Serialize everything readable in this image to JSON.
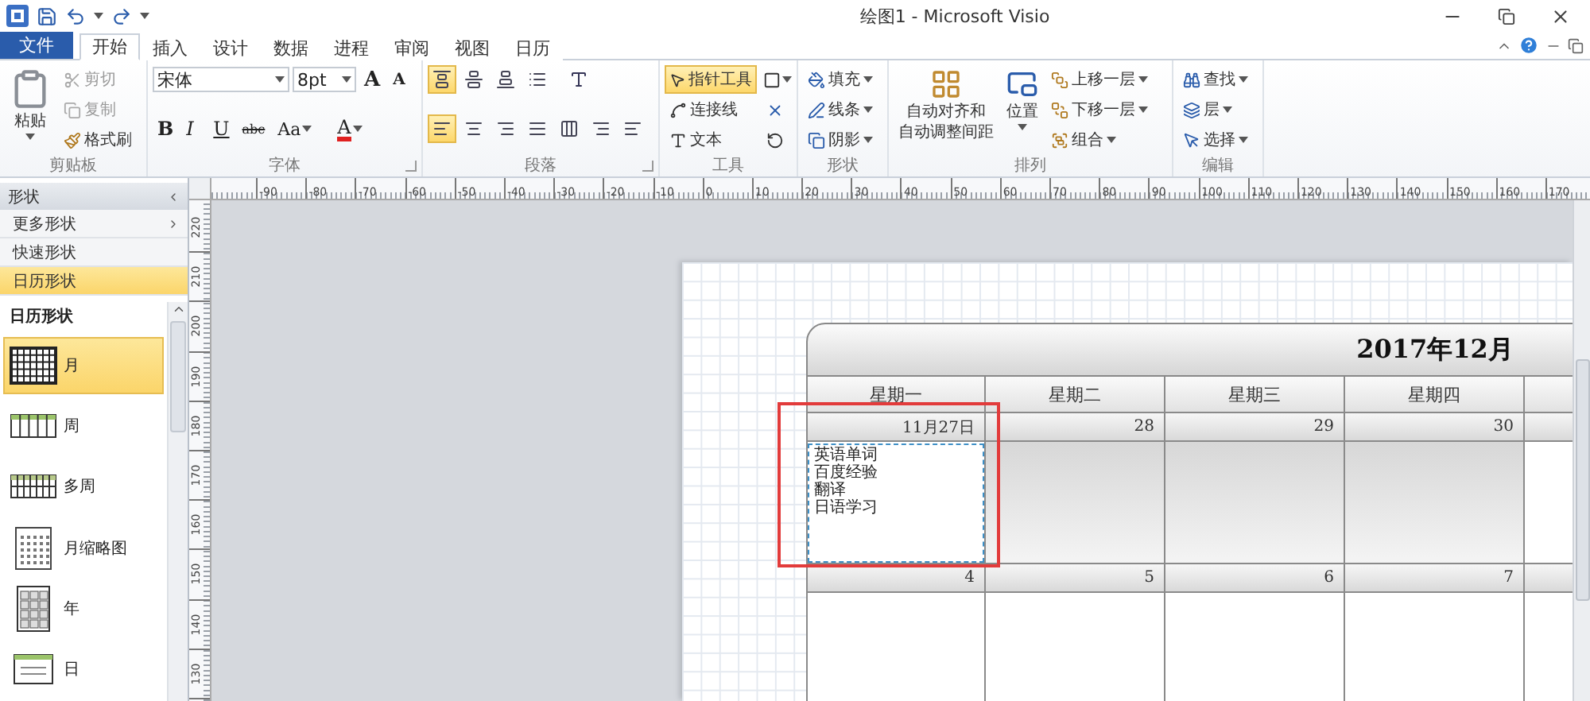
{
  "title_bar": {
    "title": "绘图1 - Microsoft Visio"
  },
  "tabs": [
    {
      "label": "文件",
      "kind": "file",
      "selected": false
    },
    {
      "label": "开始",
      "kind": "tab",
      "selected": true
    },
    {
      "label": "插入",
      "kind": "tab",
      "selected": false
    },
    {
      "label": "设计",
      "kind": "tab",
      "selected": false
    },
    {
      "label": "数据",
      "kind": "tab",
      "selected": false
    },
    {
      "label": "进程",
      "kind": "tab",
      "selected": false
    },
    {
      "label": "审阅",
      "kind": "tab",
      "selected": false
    },
    {
      "label": "视图",
      "kind": "tab",
      "selected": false
    },
    {
      "label": "日历",
      "kind": "tab",
      "selected": false
    }
  ],
  "ribbon": {
    "clipboard": {
      "label": "剪贴板",
      "paste": "粘贴",
      "items": [
        {
          "label": "剪切",
          "disabled": true
        },
        {
          "label": "复制",
          "disabled": true
        },
        {
          "label": "格式刷",
          "disabled": false
        }
      ]
    },
    "font": {
      "label": "字体",
      "font_name": "宋体",
      "font_size": "8pt",
      "grow": "A",
      "shrink": "A",
      "bold": "B",
      "italic": "I",
      "underline": "U",
      "strikethrough": "abc",
      "change_case": "Aa",
      "font_color": "A"
    },
    "paragraph": {
      "label": "段落",
      "vertical_align": [
        {
          "selected": true
        },
        {
          "selected": false
        },
        {
          "selected": false
        }
      ],
      "horizontal_align": [
        {
          "selected": true
        },
        {
          "selected": false
        },
        {
          "selected": false
        },
        {
          "selected": false
        }
      ]
    },
    "tools": {
      "label": "工具",
      "items": [
        {
          "label": "指针工具",
          "selected": true
        },
        {
          "label": "连接线",
          "selected": false
        },
        {
          "label": "文本",
          "selected": false
        }
      ]
    },
    "shape": {
      "label": "形状",
      "items": [
        "填充",
        "线条",
        "阴影"
      ]
    },
    "arrange": {
      "label": "排列",
      "auto_align": [
        "自动对齐和",
        "自动调整间距"
      ],
      "position": "位置",
      "items": [
        "上移一层",
        "下移一层",
        "组合"
      ]
    },
    "editing": {
      "label": "编辑",
      "items": [
        "查找",
        "层",
        "选择"
      ]
    }
  },
  "shapes_pane": {
    "title": "形状",
    "menu": [
      {
        "label": "更多形状",
        "kind": "submenu",
        "selected": false
      },
      {
        "label": "快速形状",
        "kind": "item",
        "selected": false
      },
      {
        "label": "日历形状",
        "kind": "item",
        "selected": true
      }
    ],
    "stencil_title": "日历形状",
    "stencil": [
      {
        "label": "月",
        "selected": true
      },
      {
        "label": "周",
        "selected": false
      },
      {
        "label": "多周",
        "selected": false
      },
      {
        "label": "月缩略图",
        "selected": false
      },
      {
        "label": "年",
        "selected": false
      },
      {
        "label": "日",
        "selected": false
      }
    ]
  },
  "rulers": {
    "horizontal": [
      "-90",
      "-80",
      "-70",
      "-60",
      "-50",
      "-40",
      "-30",
      "-20",
      "-10",
      "0",
      "10",
      "20",
      "30",
      "40",
      "50",
      "60",
      "70",
      "80",
      "90",
      "100",
      "110",
      "120",
      "130",
      "140",
      "150",
      "160",
      "170"
    ],
    "vertical": [
      "220",
      "210",
      "200",
      "190",
      "180",
      "170",
      "160",
      "150",
      "140",
      "130"
    ]
  },
  "calendar": {
    "title": "2017年12月",
    "weekdays": [
      "星期一",
      "星期二",
      "星期三",
      "星期四"
    ],
    "weeks": [
      {
        "dates": [
          "11月27日",
          "28",
          "29",
          "30"
        ],
        "cells": [
          {
            "lines": [
              "英语单词",
              "百度经验",
              "翻译",
              "日语学习"
            ],
            "selected": true
          },
          {
            "selected": false
          },
          {
            "selected": false
          },
          {
            "selected": false
          }
        ]
      },
      {
        "dates": [
          "4",
          "5",
          "6",
          "7"
        ]
      }
    ]
  }
}
